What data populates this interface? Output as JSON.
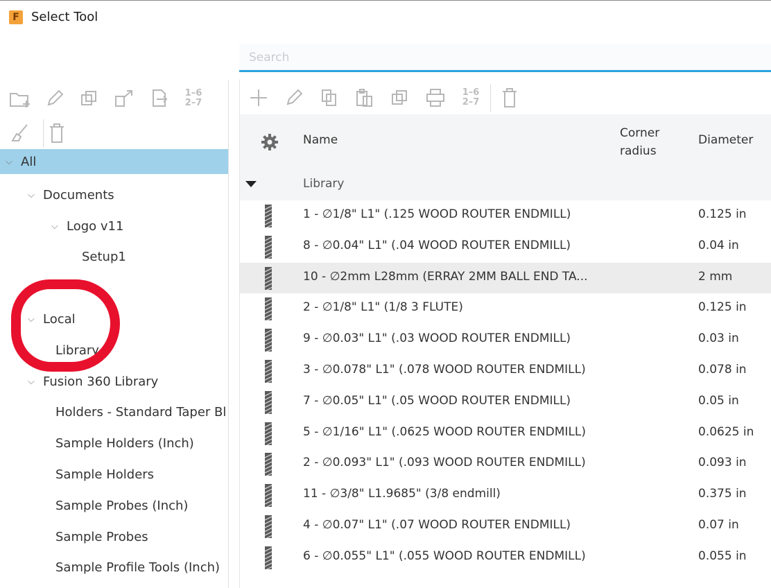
{
  "window": {
    "title": "Select Tool",
    "app_icon_letter": "F"
  },
  "search": {
    "placeholder": "Search",
    "value": ""
  },
  "left_toolbar": {
    "row1": [
      "new-folder-icon",
      "edit-icon",
      "copy-icon",
      "export-icon",
      "import-icon",
      "renumber-icon"
    ],
    "row2": [
      "clean-icon",
      "delete-icon"
    ],
    "renumber_label_top": "1–6",
    "renumber_label_bottom": "2–7"
  },
  "tree": {
    "items": [
      {
        "label": "All",
        "level": 0,
        "expanded": true,
        "selected": true
      },
      {
        "label": "Documents",
        "level": 1,
        "expanded": true
      },
      {
        "label": "Logo v11",
        "level": 2,
        "expanded": true
      },
      {
        "label": "Setup1",
        "level": 3
      },
      {
        "label": "",
        "level": 1
      },
      {
        "label": "Local",
        "level": 1,
        "expanded": true
      },
      {
        "label": "Library",
        "level": 2
      },
      {
        "label": "Fusion 360 Library",
        "level": 1,
        "expanded": true
      },
      {
        "label": "Holders - Standard Taper Bl",
        "level": 2
      },
      {
        "label": "Sample Holders (Inch)",
        "level": 2
      },
      {
        "label": "Sample Holders",
        "level": 2
      },
      {
        "label": "Sample Probes (Inch)",
        "level": 2
      },
      {
        "label": "Sample Probes",
        "level": 2
      },
      {
        "label": "Sample Profile Tools (Inch)",
        "level": 2
      }
    ]
  },
  "annotation": {
    "color": "#e8112d",
    "target": "Local"
  },
  "right_toolbar": {
    "icons": [
      "add-icon",
      "edit-icon",
      "copy-icon",
      "paste-icon",
      "duplicate-icon",
      "print-icon",
      "renumber-icon",
      "delete-icon"
    ],
    "renumber_label_top": "1–6",
    "renumber_label_bottom": "2–7"
  },
  "table": {
    "headers": {
      "settings": "gear-icon",
      "name": "Name",
      "corner_radius": "Corner radius",
      "diameter": "Diameter"
    },
    "group": "Library",
    "rows": [
      {
        "name": "1 - ∅1/8\" L1\" (.125 WOOD ROUTER ENDMILL)",
        "diameter": "0.125 in"
      },
      {
        "name": "8 - ∅0.04\" L1\" (.04 WOOD ROUTER ENDMILL)",
        "diameter": "0.04 in"
      },
      {
        "name": "10 - ∅2mm L28mm (ERRAY 2MM BALL END TA...",
        "diameter": "2 mm",
        "highlight": true
      },
      {
        "name": "2 - ∅1/8\" L1\" (1/8 3 FLUTE)",
        "diameter": "0.125 in"
      },
      {
        "name": "9 - ∅0.03\" L1\" (.03 WOOD ROUTER ENDMILL)",
        "diameter": "0.03 in"
      },
      {
        "name": "3 - ∅0.078\" L1\" (.078 WOOD ROUTER ENDMILL)",
        "diameter": "0.078 in"
      },
      {
        "name": "7 - ∅0.05\" L1\" (.05 WOOD ROUTER ENDMILL)",
        "diameter": "0.05 in"
      },
      {
        "name": "5 - ∅1/16\" L1\" (.0625 WOOD ROUTER ENDMILL)",
        "diameter": "0.0625 in"
      },
      {
        "name": "2 - ∅0.093\" L1\" (.093 WOOD ROUTER ENDMILL)",
        "diameter": "0.093 in"
      },
      {
        "name": "11 - ∅3/8\" L1.9685\" (3/8 endmill)",
        "diameter": "0.375 in"
      },
      {
        "name": "4 - ∅0.07\" L1\" (.07 WOOD ROUTER ENDMILL)",
        "diameter": "0.07 in"
      },
      {
        "name": "6 - ∅0.055\" L1\" (.055 WOOD ROUTER ENDMILL)",
        "diameter": "0.055 in"
      }
    ]
  },
  "colors": {
    "accent": "#29a3df",
    "selection": "#9fd1ea",
    "row_highlight": "#ececec",
    "header_bg": "#f4f5f6"
  }
}
